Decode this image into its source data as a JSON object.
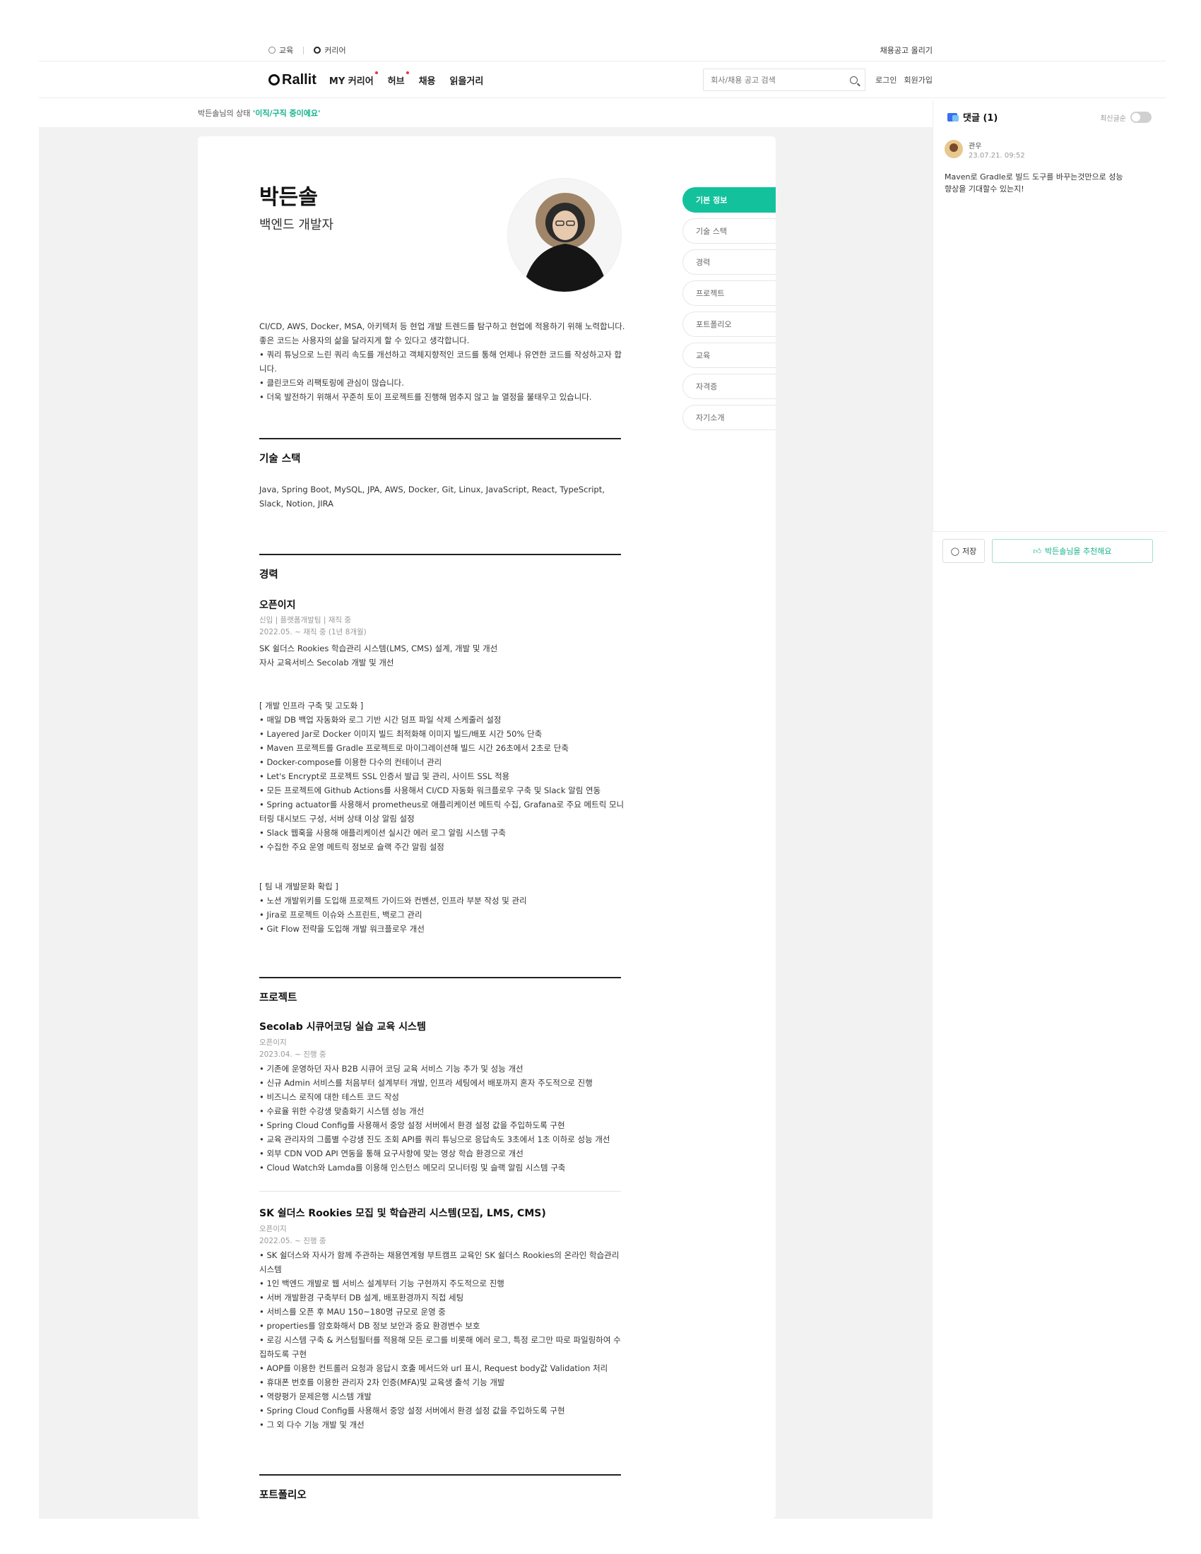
{
  "topbar": {
    "education": "교육",
    "career": "커리어",
    "post_job": "채용공고 올리기"
  },
  "nav": {
    "logo": "Rallit",
    "menus": [
      "MY 커리어",
      "허브",
      "채용",
      "읽을거리"
    ],
    "search_placeholder": "회사/채용 공고 검색",
    "login": "로그인",
    "signup": "회원가입"
  },
  "status": {
    "prefix": "박든솔님의 상태",
    "value": "'이직/구직 중이에요'"
  },
  "profile": {
    "name": "박든솔",
    "job": "백엔드 개발자",
    "intro": [
      "CI/CD, AWS, Docker, MSA, 아키텍처 등 현업 개발 트렌드를 탐구하고 현업에 적용하기 위해 노력합니다.",
      "좋은 코드는 사용자의 삶을 달라지게 할 수 있다고 생각합니다.",
      "• 쿼리 튜닝으로 느린 쿼리 속도를 개선하고 객체지향적인 코드를 통해 언제나 유연한 코드를 작성하고자 합니다.",
      "• 클린코드와 리팩토링에 관심이 많습니다.",
      "• 더욱 발전하기 위해서 꾸준히 토이 프로젝트를 진행해 멈추지 않고 늘 열정을 불태우고 있습니다."
    ]
  },
  "skills": {
    "title": "기술 스택",
    "text": "Java, Spring Boot, MySQL, JPA, AWS, Docker, Git, Linux, JavaScript, React, TypeScript, Slack, Notion, JIRA"
  },
  "career": {
    "title": "경력",
    "company": "오픈이지",
    "meta1": "신입 | 플랫폼개발팀 | 재직 중",
    "meta2": "2022.05. ~ 재직 중 (1년 8개월)",
    "summary": [
      "SK 쉴더스 Rookies 학습관리 시스템(LMS, CMS) 설계, 개발 및 개선",
      "자사 교육서비스 Secolab 개발 및 개선"
    ],
    "infra_title": "[ 개발 인프라 구축 및 고도화 ]",
    "infra": [
      "• 매일 DB 백업 자동화와 로그 기반 시간 덤프 파일 삭제 스케줄러 설정",
      "• Layered Jar로 Docker 이미지 빌드 최적화해 이미지 빌드/배포 시간 50% 단축",
      "• Maven 프로젝트를 Gradle 프로젝트로 마이그레이션해 빌드 시간 26초에서 2초로 단축",
      "• Docker-compose를 이용한 다수의 컨테이너 관리",
      "• Let's Encrypt로 프로젝트 SSL 인증서 발급 및 관리, 사이트 SSL 적용",
      "• 모든 프로젝트에 Github Actions를 사용해서 CI/CD 자동화 워크플로우 구축 및 Slack 알림 연동",
      "• Spring actuator를 사용해서 prometheus로 애플리케이션 메트릭 수집, Grafana로 주요 메트릭 모니터링 대시보드 구성, 서버 상태 이상 알림 설정",
      "• Slack 웹훅을 사용해 애플리케이션 실시간 에러 로그 알림 시스템 구축",
      "• 수집한 주요 운영 메트릭 정보로 슬랙 주간 알림 설정"
    ],
    "team_title": "[ 팀 내 개발문화 확립 ]",
    "team": [
      "• 노션 개발위키를 도입해 프로젝트 가이드와 컨벤션, 인프라 부분 작성 및 관리",
      "• Jira로 프로젝트 이슈와 스프린트, 백로그 관리",
      "• Git Flow 전략을 도입해 개발 워크플로우 개선"
    ]
  },
  "projects": {
    "title": "프로젝트",
    "items": [
      {
        "name": "Secolab 시큐어코딩 실습 교육 시스템",
        "org": "오픈이지",
        "period": "2023.04. ~ 진행 중",
        "bullets": [
          "• 기존에 운영하던 자사 B2B 시큐어 코딩 교육 서비스 기능 추가 및 성능 개선",
          "• 신규 Admin 서비스를 처음부터 설계부터 개발, 인프라 세팅에서 배포까지 혼자 주도적으로 진행",
          "• 비즈니스 로직에 대한 테스트 코드 작성",
          "• 수료율 위한 수강생 맞춤화기 시스템 성능 개선",
          "• Spring Cloud Config를 사용해서 중앙 설정 서버에서 환경 설정 값을 주입하도록 구현",
          "• 교육 관리자의 그룹별 수강생 진도 조회 API를 쿼리 튜닝으로 응답속도 3초에서 1초 이하로 성능 개선",
          "• 외부 CDN VOD API 연동을 통해 요구사항에 맞는 영상 학습 환경으로 개선",
          "• Cloud Watch와 Lamda를 이용해 인스턴스 메모리 모니터링 및 슬랙 알림 시스템 구축"
        ]
      },
      {
        "name": "SK 쉴더스 Rookies 모집 및 학습관리 시스템(모집, LMS, CMS)",
        "org": "오픈이지",
        "period": "2022.05. ~ 진행 중",
        "bullets": [
          "• SK 쉴더스와 자사가 함께 주관하는 채용연계형 부트캠프 교육인 SK 쉴더스 Rookies의 온라인 학습관리 시스템",
          "• 1인 백엔드 개발로 웹 서비스 설계부터 기능 구현까지 주도적으로 진행",
          "• 서버 개발환경 구축부터 DB 설계, 배포환경까지 직접 세팅",
          "• 서비스를 오픈 후 MAU 150~180명 규모로 운영 중",
          "• properties를 암호화해서 DB 정보 보안과 중요 환경변수 보호",
          "• 로깅 시스템 구축 & 커스텀필터를 적용해 모든 로그를 비롯해 에러 로그, 특정 로그만 따로 파일링하여 수집하도록 구현",
          "• AOP를 이용한 컨트롤러 요청과 응답시 호출 메서드와 url 표시, Request body값 Validation 처리",
          "• 휴대폰 번호를 이용한 관리자 2차 인증(MFA)및 교육생 출석 기능 개발",
          "• 역량평가 문제은행 시스템 개발",
          "• Spring Cloud Config를 사용해서 중앙 설정 서버에서 환경 설정 값을 주입하도록 구현",
          "• 그 외 다수 기능 개발 및 개선"
        ]
      }
    ]
  },
  "portfolio": {
    "title": "포트폴리오"
  },
  "sidenav": [
    "기본 정보",
    "기술 스택",
    "경력",
    "프로젝트",
    "포트폴리오",
    "교육",
    "자격증",
    "자기소개"
  ],
  "comments": {
    "title": "댓글 (1)",
    "toggle_label": "최신글순",
    "user": "관우",
    "time": "23.07.21. 09:52",
    "body": "Maven로 Gradle로 빌드 도구를 바꾸는것만으로 성능 향상을 기대할수 있는지!",
    "save": "저장",
    "recommend": "박든솔님을 추천해요"
  }
}
